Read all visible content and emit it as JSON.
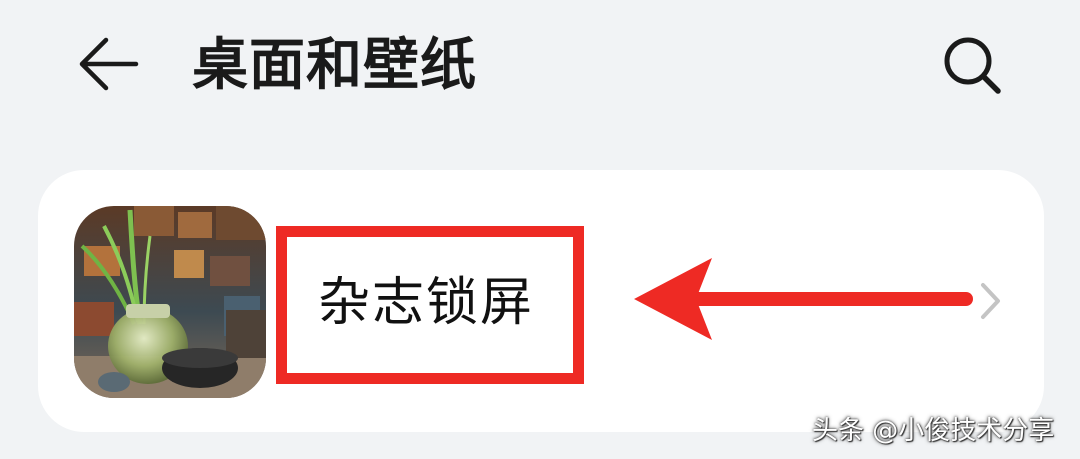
{
  "header": {
    "title": "桌面和壁纸",
    "back_icon": "arrow-left-icon",
    "search_icon": "search-icon"
  },
  "settings_list": {
    "items": [
      {
        "label": "杂志锁屏",
        "thumbnail": "plant-in-glass-jar-image",
        "trailing_icon": "chevron-right-icon"
      }
    ]
  },
  "annotation": {
    "highlight_color": "#ee2a24",
    "arrow_icon": "red-arrow-left-icon"
  },
  "watermark": {
    "text": "头条 @小俊技术分享"
  },
  "colors": {
    "background": "#f1f3f5",
    "card": "#ffffff",
    "text_primary": "#1a1a1a",
    "chevron": "#c4c4c4",
    "annotation_red": "#ee2a24"
  }
}
